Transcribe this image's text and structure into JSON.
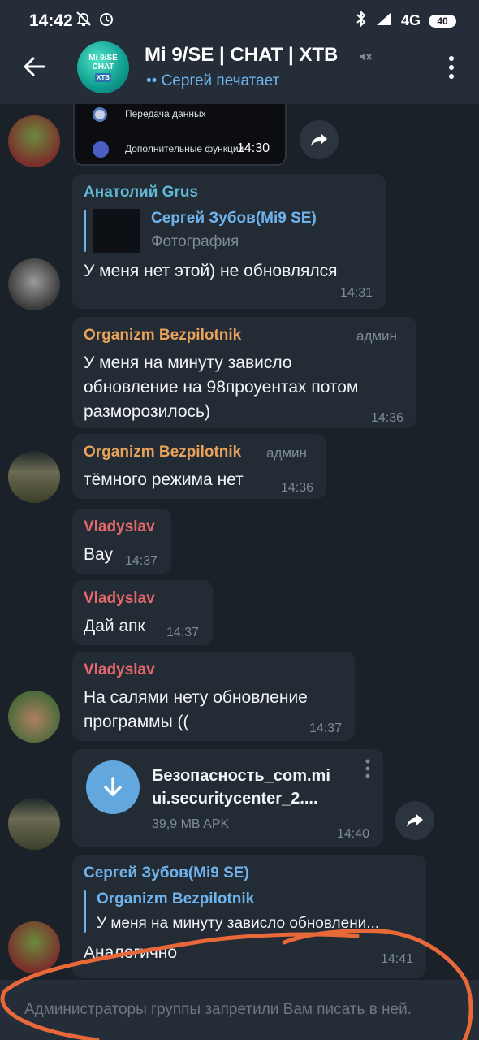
{
  "status_bar": {
    "time": "14:42",
    "network": "4G",
    "battery": "40"
  },
  "header": {
    "avatar_lines": [
      "Mi 9/SE",
      "CHAT",
      "XTB"
    ],
    "title": "Mi 9/SE | CHAT | XTB",
    "subtitle": "•• Сергей печатает"
  },
  "messages": {
    "screenshot_msg": {
      "row1": "Передача данных",
      "row2": "Дополнительные функции",
      "time": "14:30"
    },
    "m1": {
      "sender": "Анатолий Grus",
      "reply_name": "Сергей Зубов(Mi9 SE)",
      "reply_text": "Фотография",
      "text": "У меня нет этой) не обновлялся",
      "time": "14:31"
    },
    "m2": {
      "sender": "Organizm Bezpilotnik",
      "badge": "админ",
      "line1": "У меня на минуту зависло",
      "line2": "обновление на 98проуентах потом",
      "line3": "разморозилось)",
      "time": "14:36"
    },
    "m3": {
      "sender": "Organizm Bezpilotnik",
      "badge": "админ",
      "text": "тёмного режима нет",
      "time": "14:36"
    },
    "m4": {
      "sender": "Vladyslav",
      "text": "Вау",
      "time": "14:37"
    },
    "m5": {
      "sender": "Vladyslav",
      "text": "Дай апк",
      "time": "14:37"
    },
    "m6": {
      "sender": "Vladyslav",
      "line1": "На салями нету обновление",
      "line2": "программы ((",
      "time": "14:37"
    },
    "file": {
      "name_line1": "Безопасность_com.mi",
      "name_line2": "ui.securitycenter_2....",
      "size": "39,9 MB APK",
      "time": "14:40"
    },
    "m7": {
      "sender": "Сергей Зубов(Mi9 SE)",
      "reply_name": "Organizm Bezpilotnik",
      "reply_text": "У меня на минуту зависло обновлени...",
      "text": "Аналогично",
      "time": "14:41"
    }
  },
  "input_bar": {
    "placeholder": "Администраторы группы запретили Вам писать в ней."
  },
  "colors": {
    "background": "#1b2129",
    "bubble": "#232b35",
    "accent_blue": "#6fb3ec",
    "orange_name": "#e8a25a",
    "red_name": "#e6686b",
    "teal_name": "#60b8d4",
    "scribble": "#e8683a"
  }
}
